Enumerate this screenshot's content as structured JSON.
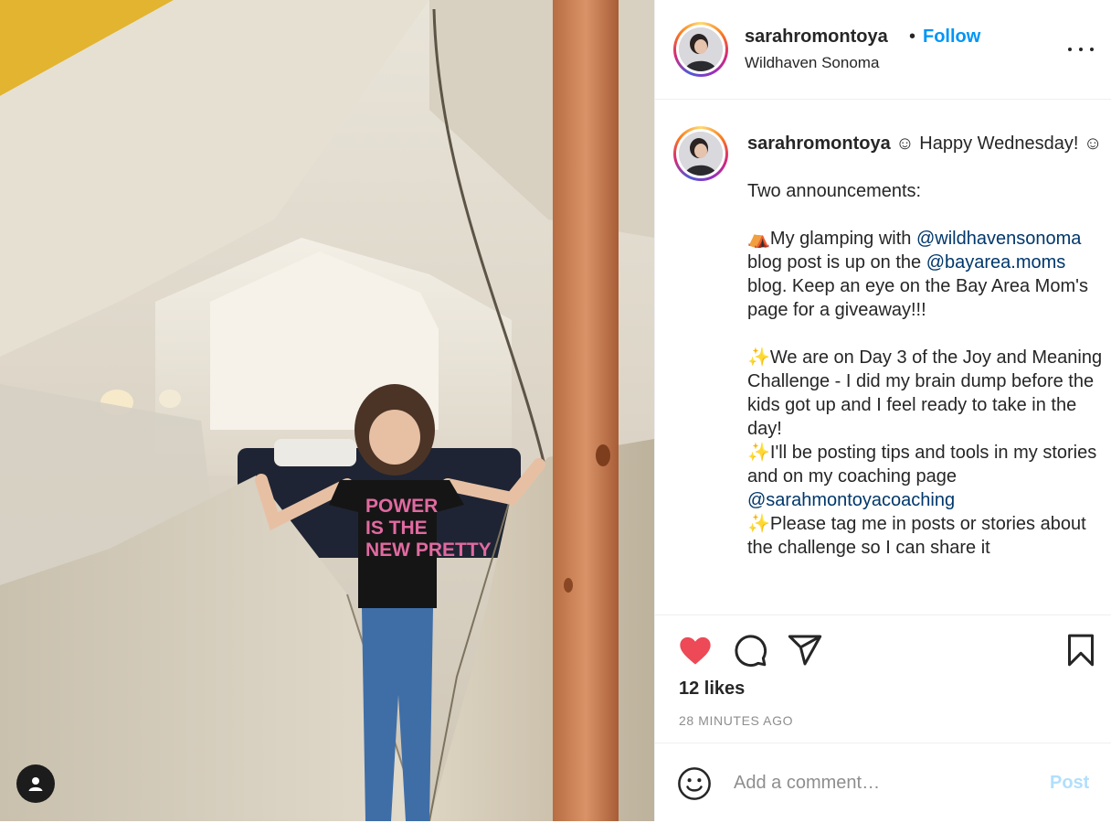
{
  "post": {
    "author": "sarahromontoya",
    "separator": "•",
    "follow_label": "Follow",
    "location": "Wildhaven Sonoma",
    "more_icon": "more-horizontal-icon"
  },
  "caption": {
    "username": "sarahromontoya",
    "lines": {
      "l1": " ☺ Happy Wednesday! ☺",
      "l2": "Two announcements:",
      "l3a": "⛺My glamping with ",
      "m1": "@wildhavensonoma",
      "l3b": " blog post is up on the ",
      "m2": "@bayarea.moms",
      "l3c": " blog. Keep an eye on the Bay Area Mom's page for a giveaway!!!",
      "l4": "✨We are on Day 3 of the Joy and Meaning Challenge - I did my brain dump before the kids got up and I feel ready to take in the day!",
      "l5": "✨I'll be posting tips and tools in my stories and on my coaching page ",
      "m3": "@sarahmontoyacoaching",
      "l6": "✨Please tag me in posts or stories about the challenge so I can share it"
    }
  },
  "engagement": {
    "likes": "12 likes",
    "time_ago": "28 MINUTES AGO",
    "liked": true,
    "icons": [
      "heart-icon",
      "comment-icon",
      "share-icon",
      "bookmark-icon"
    ]
  },
  "comment": {
    "placeholder": "Add a comment…",
    "post_label": "Post"
  },
  "colors": {
    "accent": "#0095f6",
    "like": "#ed4956",
    "post_disabled": "#b2dffc",
    "mention": "#00376b"
  }
}
